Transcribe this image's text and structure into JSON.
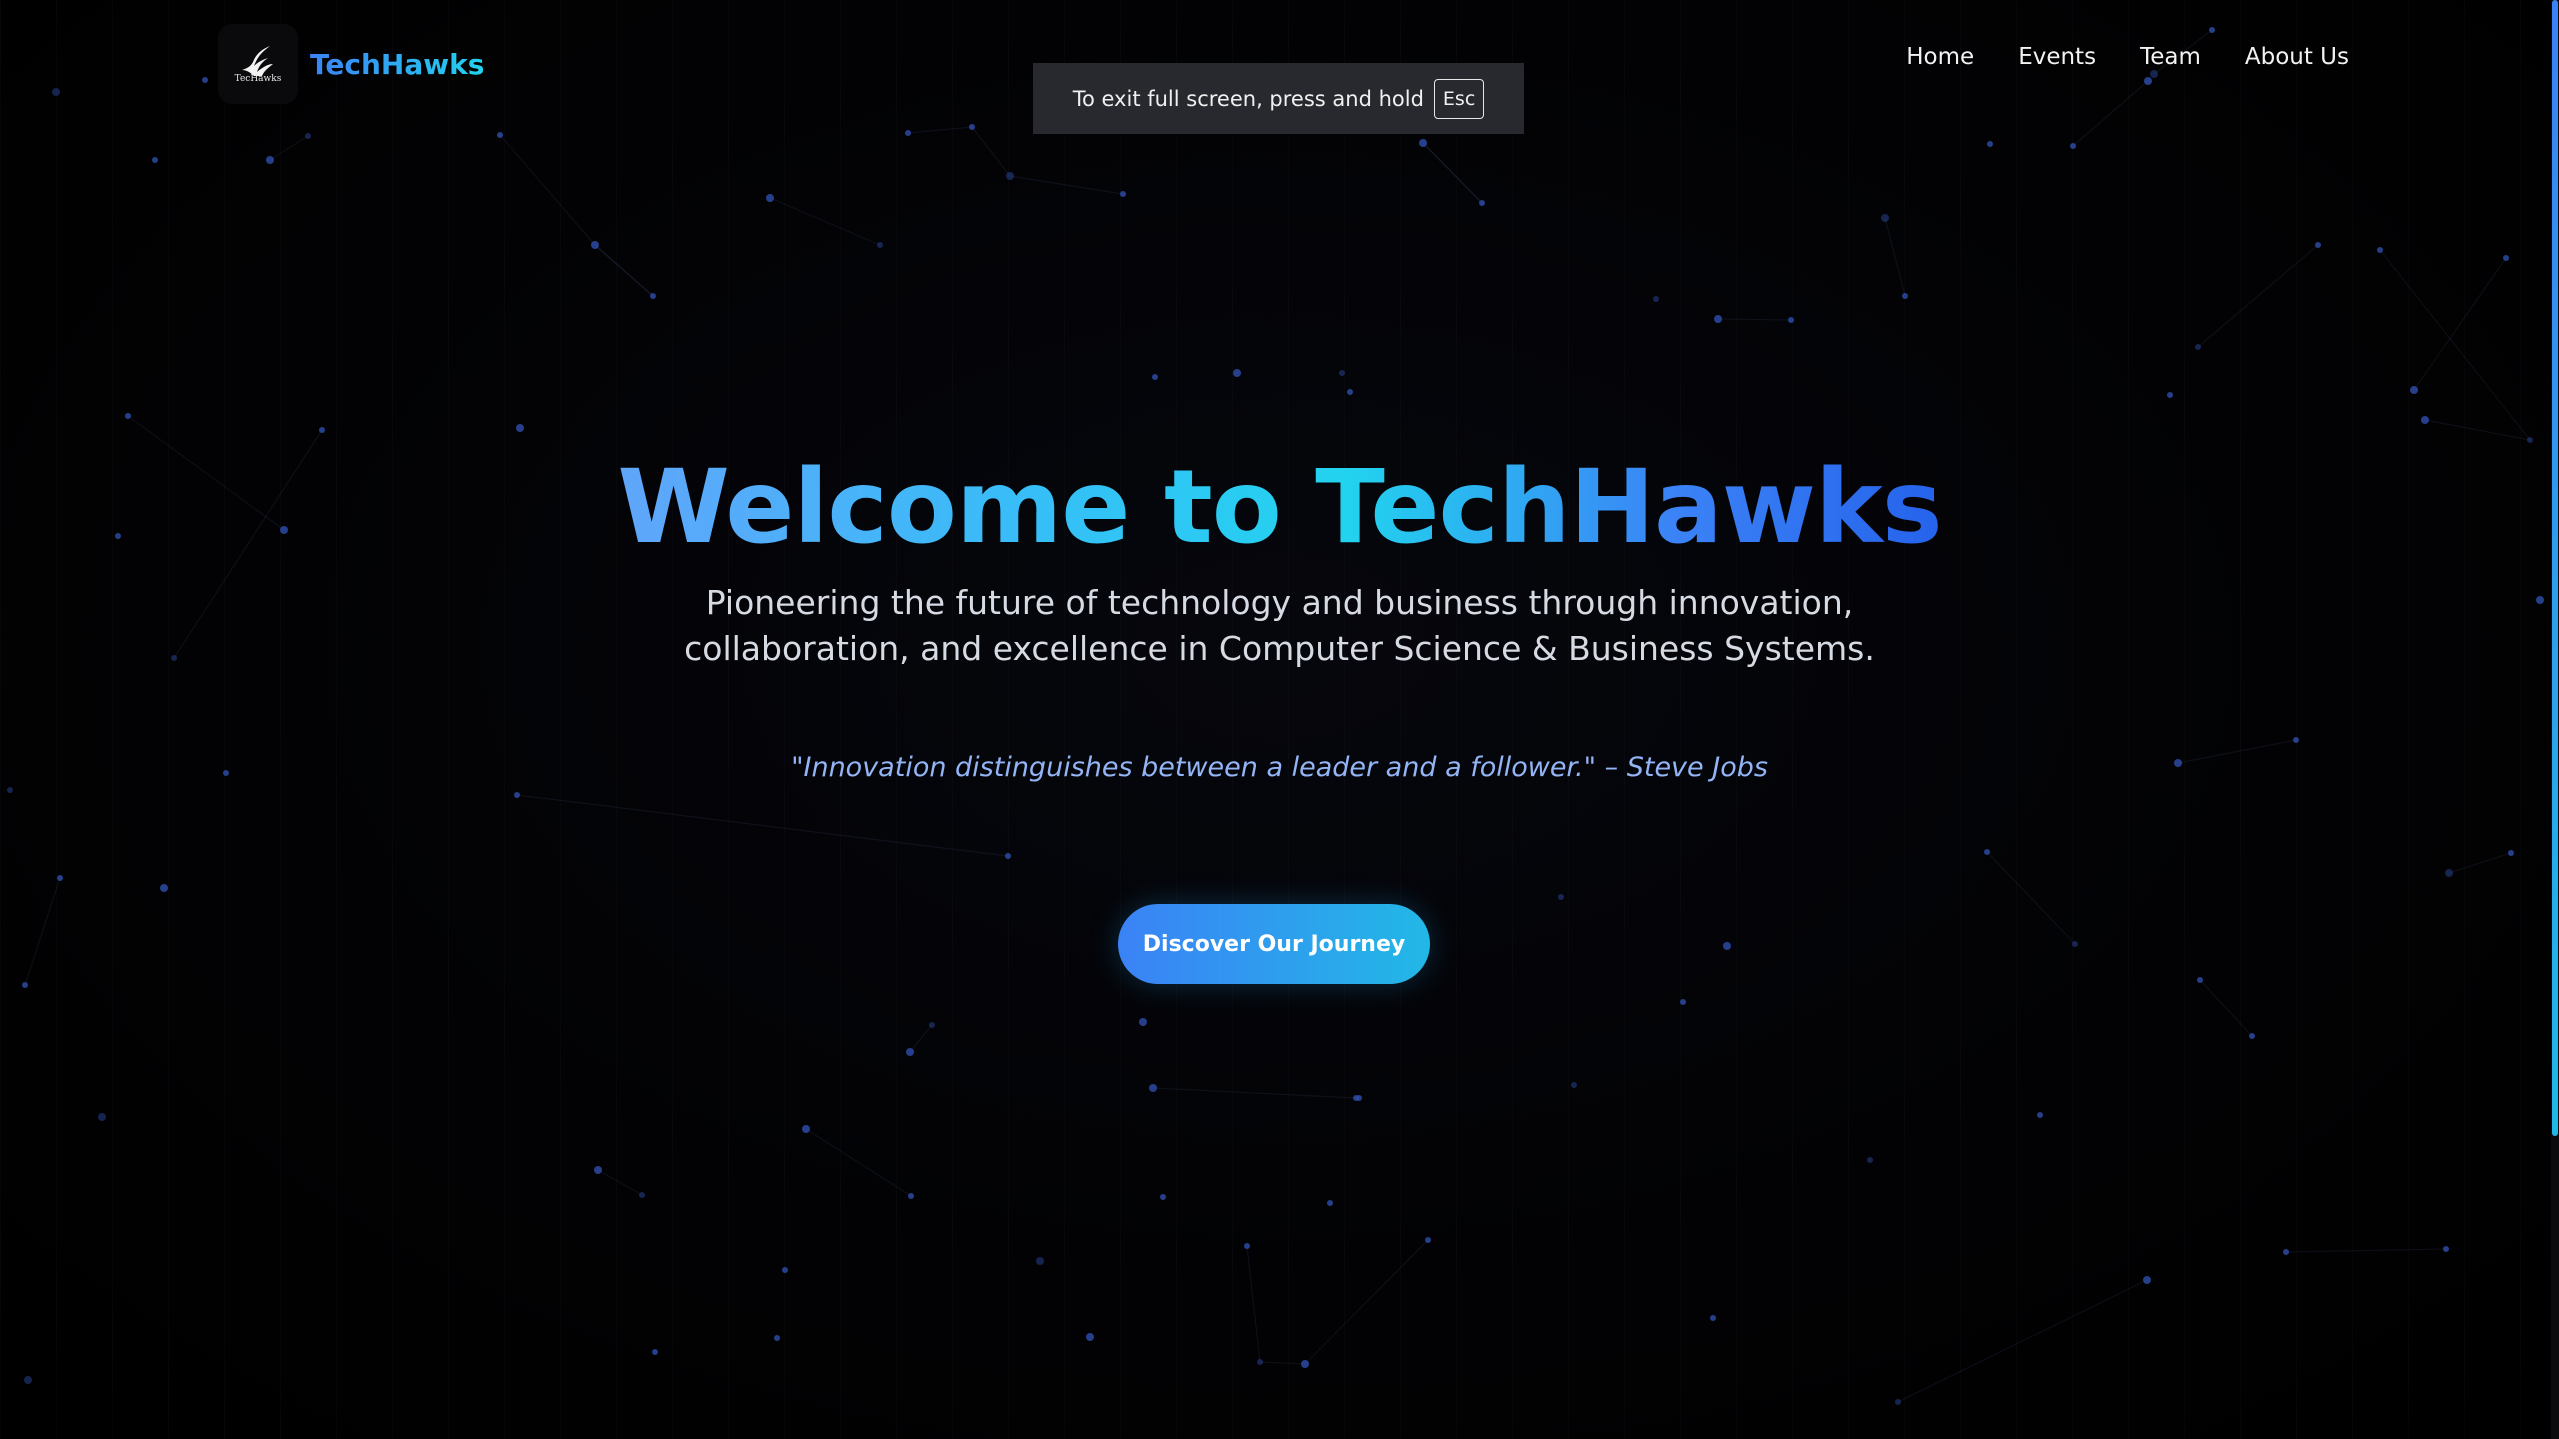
{
  "brand": {
    "logo_text": "TecHawks",
    "name": "TechHawks"
  },
  "nav": {
    "items": [
      {
        "label": "Home"
      },
      {
        "label": "Events"
      },
      {
        "label": "Team"
      },
      {
        "label": "About Us"
      }
    ]
  },
  "fullscreen_notice": {
    "text": "To exit full screen, press and hold",
    "key": "Esc"
  },
  "hero": {
    "title": "Welcome to TechHawks",
    "subtitle_line1": "Pioneering the future of technology and business through innovation,",
    "subtitle_line2": "collaboration, and excellence in Computer Science & Business Systems.",
    "quote": "\"Innovation distinguishes between a leader and a follower.\" – Steve Jobs",
    "cta_label": "Discover Our Journey"
  },
  "theme": {
    "background": "#000000",
    "accent_blue": "#3b82f6",
    "accent_cyan": "#22d3ee",
    "particle_color": "#2f4fae"
  },
  "icons": {
    "logo": "hawk-wing-icon"
  }
}
